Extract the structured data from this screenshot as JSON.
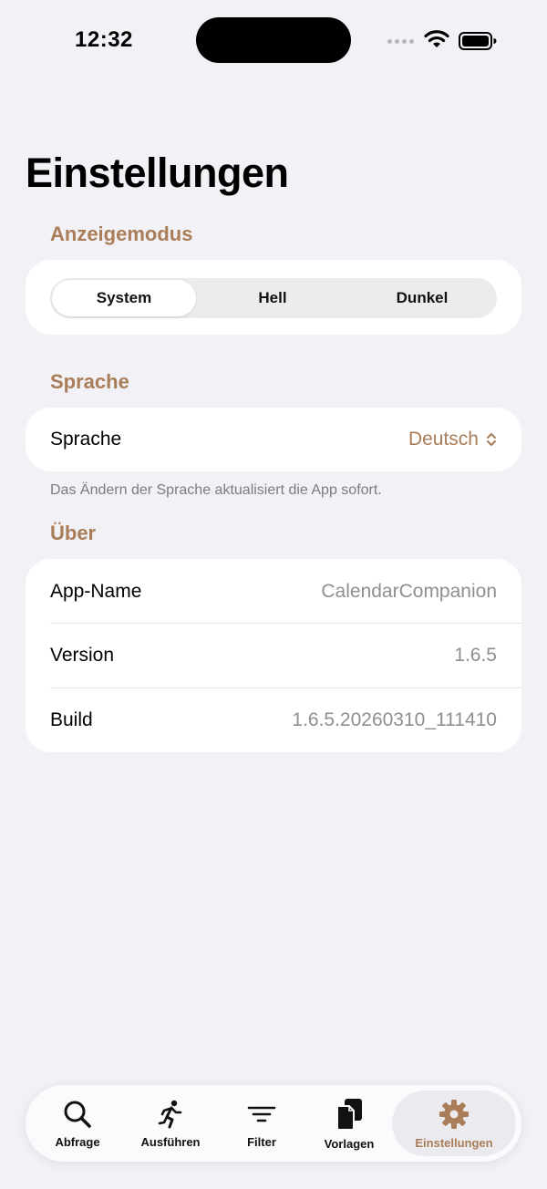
{
  "status_bar": {
    "time": "12:32"
  },
  "page": {
    "title": "Einstellungen"
  },
  "display_mode": {
    "section_title": "Anzeigemodus",
    "options": [
      "System",
      "Hell",
      "Dunkel"
    ],
    "selected": "System"
  },
  "language": {
    "section_title": "Sprache",
    "row_label": "Sprache",
    "value": "Deutsch",
    "footnote": "Das Ändern der Sprache aktualisiert die App sofort."
  },
  "about": {
    "section_title": "Über",
    "rows": [
      {
        "label": "App-Name",
        "value": "CalendarCompanion"
      },
      {
        "label": "Version",
        "value": "1.6.5"
      },
      {
        "label": "Build",
        "value": "1.6.5.20260310_111410"
      }
    ]
  },
  "tab_bar": {
    "tabs": [
      {
        "label": "Abfrage",
        "icon": "magnifyingglass-icon"
      },
      {
        "label": "Ausführen",
        "icon": "running-figure-icon"
      },
      {
        "label": "Filter",
        "icon": "filter-lines-icon"
      },
      {
        "label": "Vorlagen",
        "icon": "documents-icon"
      },
      {
        "label": "Einstellungen",
        "icon": "gear-icon"
      }
    ],
    "active": "Einstellungen"
  },
  "colors": {
    "accent": "#a97d58",
    "background": "#f2f1f6",
    "card": "#ffffff"
  }
}
